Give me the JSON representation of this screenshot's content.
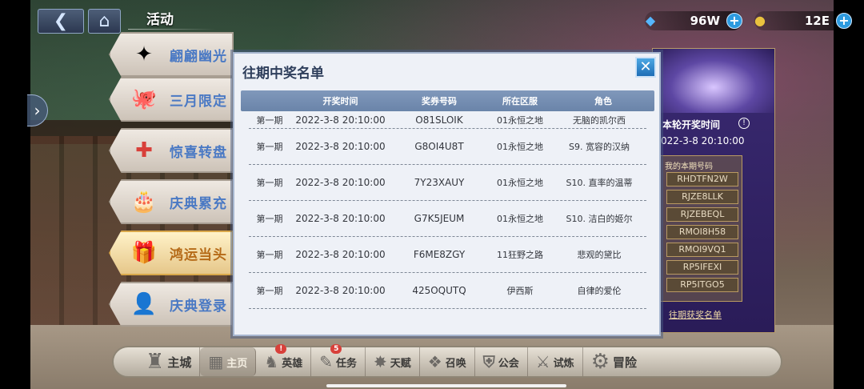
{
  "header": {
    "back_icon": "arrow-left-icon",
    "home_icon": "home-icon",
    "title": "活动"
  },
  "currencies": [
    {
      "name": "gem",
      "icon": "crystal-icon",
      "value": "96W"
    },
    {
      "name": "gold",
      "icon": "coin-icon",
      "value": "12E"
    }
  ],
  "tabs": [
    {
      "label": "翩翩幽光",
      "art": "✦"
    },
    {
      "label": "三月限定",
      "art": "🐙"
    },
    {
      "label": "惊喜转盘",
      "art": "✚"
    },
    {
      "label": "庆典累充",
      "art": "🎂"
    },
    {
      "label": "鸿运当头",
      "art": "🎁"
    },
    {
      "label": "庆典登录",
      "art": "👤"
    }
  ],
  "modal": {
    "title": "往期中奖名单",
    "close_label": "✕",
    "columns": [
      "开奖时间",
      "奖券号码",
      "所在区服",
      "角色"
    ],
    "rows": [
      {
        "period": "第一期",
        "time": "2022-3-8  20:10:00",
        "code": "O81SLOIK",
        "server": "01永恒之地",
        "role": "无脑的凯尔西"
      },
      {
        "period": "第一期",
        "time": "2022-3-8  20:10:00",
        "code": "G8OI4U8T",
        "server": "01永恒之地",
        "role": "S9. 宽容的汉纳"
      },
      {
        "period": "第一期",
        "time": "2022-3-8  20:10:00",
        "code": "7Y23XAUY",
        "server": "01永恒之地",
        "role": "S10. 直率的温蒂"
      },
      {
        "period": "第一期",
        "time": "2022-3-8  20:10:00",
        "code": "G7K5JEUM",
        "server": "01永恒之地",
        "role": "S10. 洁白的姬尔"
      },
      {
        "period": "第一期",
        "time": "2022-3-8  20:10:00",
        "code": "F6ME8ZGY",
        "server": "11狂野之路",
        "role": "悲观的黛比"
      },
      {
        "period": "第一期",
        "time": "2022-3-8  20:10:00",
        "code": "425OQUTQ",
        "server": "伊西斯",
        "role": "自律的爱伦"
      }
    ]
  },
  "right_panel": {
    "draw_time_title": "本轮开奖时间",
    "draw_time": "022-3-8  20:10:00",
    "my_codes_title": "我的本期号码",
    "codes": [
      "RHDTFN2W",
      "RJZE8LLK",
      "RJZEBEQL",
      "RMOI8H58",
      "RMOI9VQ1",
      "RP5IFEXI",
      "RP5ITGO5"
    ],
    "history_link": "往期获奖名单"
  },
  "bottom_nav": [
    {
      "label": "主城",
      "icon": "castle-icon",
      "badge": ""
    },
    {
      "label": "主页",
      "icon": "homepage-icon",
      "badge": ""
    },
    {
      "label": "英雄",
      "icon": "hero-icon",
      "badge": "!"
    },
    {
      "label": "任务",
      "icon": "quest-icon",
      "badge": "5"
    },
    {
      "label": "天赋",
      "icon": "talent-icon",
      "badge": ""
    },
    {
      "label": "召唤",
      "icon": "summon-icon",
      "badge": ""
    },
    {
      "label": "公会",
      "icon": "guild-icon",
      "badge": ""
    },
    {
      "label": "试炼",
      "icon": "trial-icon",
      "badge": ""
    },
    {
      "label": "冒险",
      "icon": "adventure-icon",
      "badge": ""
    }
  ]
}
